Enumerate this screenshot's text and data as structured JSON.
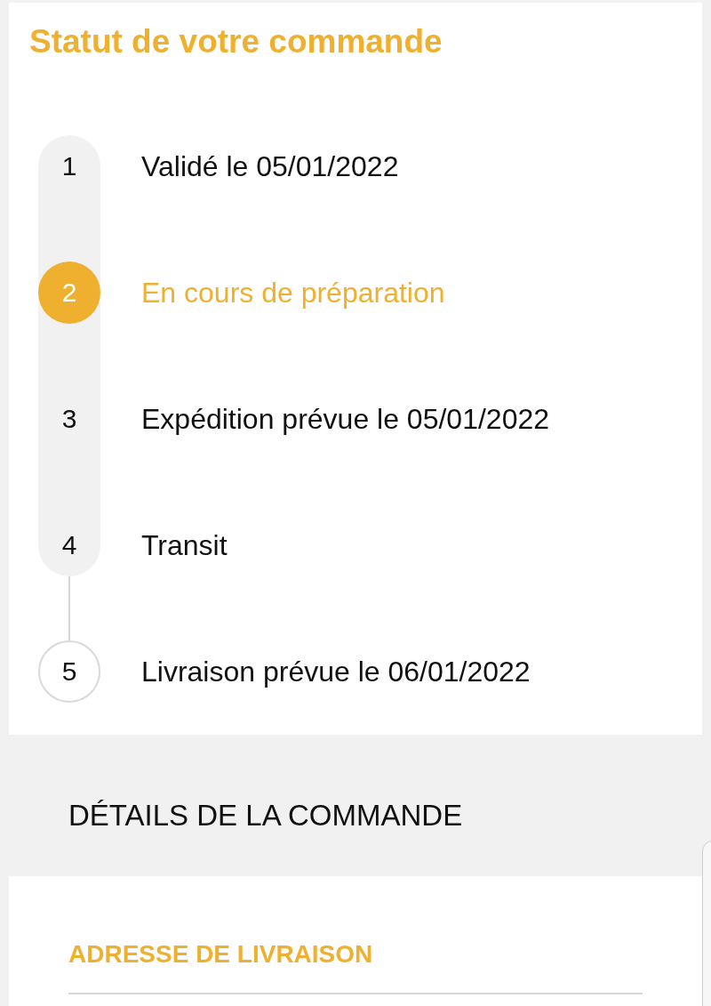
{
  "order_status": {
    "title": "Statut de votre commande",
    "steps": [
      {
        "number": "1",
        "label": "Validé le 05/01/2022",
        "selected": false,
        "reached": true
      },
      {
        "number": "2",
        "label": "En cours de préparation",
        "selected": true,
        "reached": true
      },
      {
        "number": "3",
        "label": "Expédition prévue le 05/01/2022",
        "selected": false,
        "reached": true
      },
      {
        "number": "4",
        "label": "Transit",
        "selected": false,
        "reached": true
      },
      {
        "number": "5",
        "label": "Livraison prévue le 06/01/2022",
        "selected": false,
        "reached": false
      }
    ]
  },
  "order_details": {
    "heading": "DÉTAILS DE LA COMMANDE",
    "sections": [
      {
        "title": "ADRESSE DE LIVRAISON"
      }
    ]
  }
}
